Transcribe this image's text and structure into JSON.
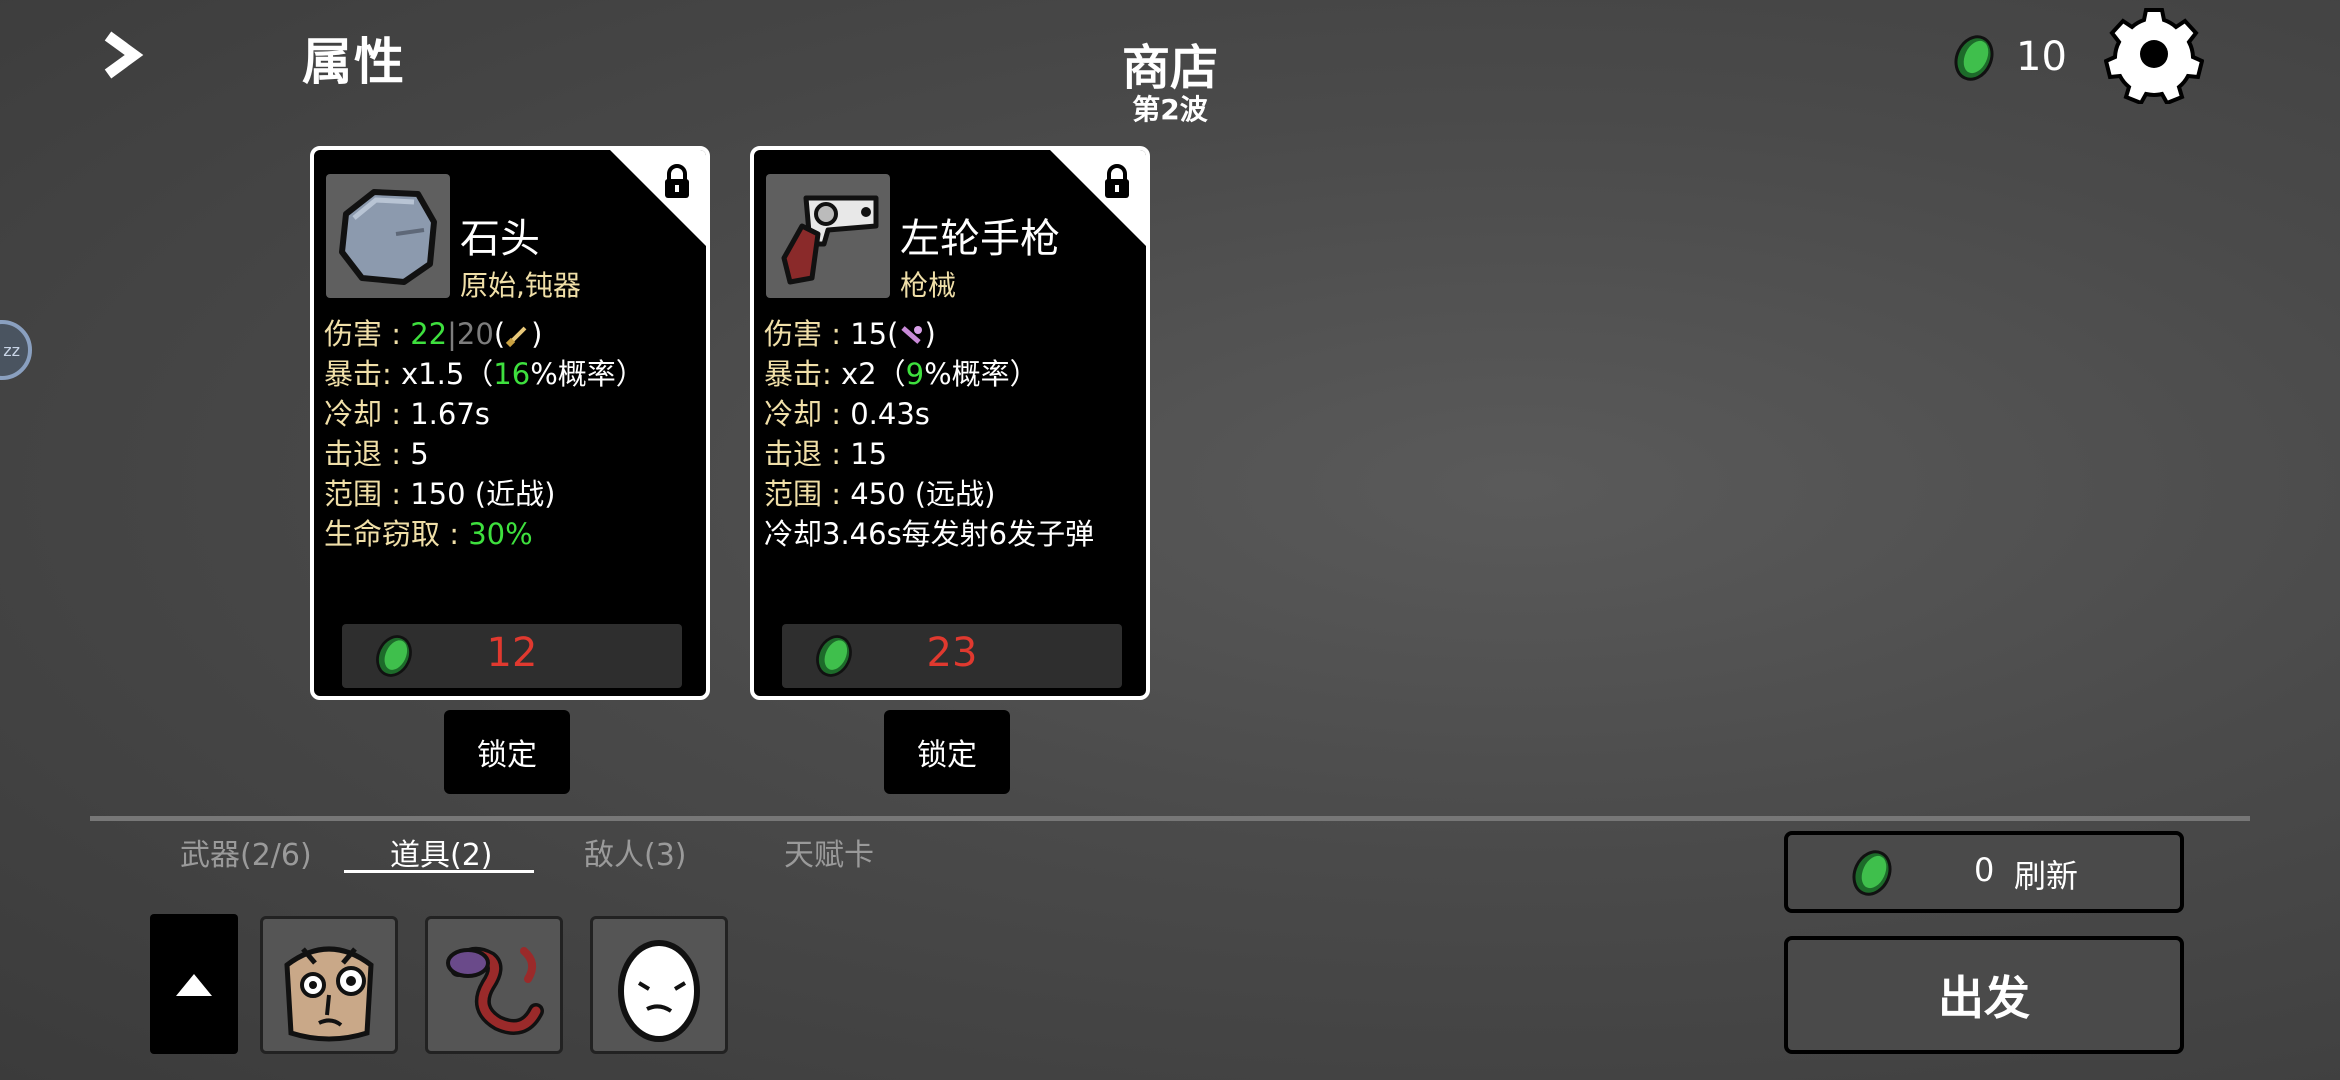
{
  "header": {
    "attributes_title": "属性",
    "shop_title": "商店",
    "wave_label": "第2波",
    "gold": "10"
  },
  "side_bubble": "zz",
  "cards": [
    {
      "name": "石头",
      "tags": "原始,钝器",
      "icon": "rock-icon",
      "damage_label": "伤害 : ",
      "damage_value": "22",
      "damage_sep": "|",
      "damage_base": "20",
      "damage_open": "(",
      "damage_close": ")",
      "crit_label": "暴击: ",
      "crit_mult": " x1.5（",
      "crit_chance": "16",
      "crit_suffix": "%概率）",
      "cooldown_label": "冷却 : ",
      "cooldown_value": "1.67s",
      "knockback_label": "击退 : ",
      "knockback_value": "5",
      "range_label": "范围 : ",
      "range_value": "150 (近战)",
      "lifesteal_label": "生命窃取 : ",
      "lifesteal_value": "30%",
      "price": "12",
      "lock_label": "锁定"
    },
    {
      "name": "左轮手枪",
      "tags": "枪械",
      "icon": "revolver-icon",
      "damage_label": "伤害 : ",
      "damage_value": "15",
      "damage_open": "(",
      "damage_close": ")",
      "crit_label": "暴击: ",
      "crit_mult": " x2（",
      "crit_chance": "9",
      "crit_suffix": "%概率）",
      "cooldown_label": "冷却 : ",
      "cooldown_value": "0.43s",
      "knockback_label": "击退 : ",
      "knockback_value": "15",
      "range_label": "范围 : ",
      "range_value": "450 (远战)",
      "special": "冷却3.46s每发射6发子弹",
      "price": "23",
      "lock_label": "锁定"
    }
  ],
  "tabs": [
    {
      "label": "武器(2/6)",
      "active": false
    },
    {
      "label": "道具(2)",
      "active": true
    },
    {
      "label": "敌人(3)",
      "active": false
    },
    {
      "label": "天赋卡",
      "active": false
    }
  ],
  "inventory": [
    "sack-face-icon",
    "snake-icon",
    "egg-icon"
  ],
  "refresh": {
    "cost": "0",
    "label": "刷新"
  },
  "go_label": "出发",
  "colors": {
    "price": "#e0392f",
    "highlight": "#3ee03e",
    "stat_key": "#f0dfa8"
  }
}
